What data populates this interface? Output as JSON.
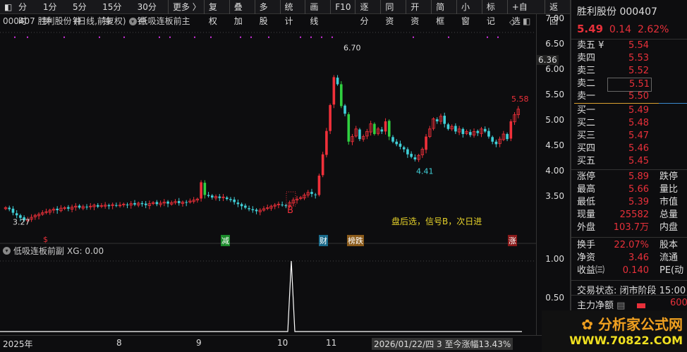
{
  "toolbar": {
    "items": [
      "分时",
      "1分钟",
      "5分钟",
      "15分钟",
      "30分钟",
      "更多 〉",
      "复权",
      "叠加",
      "多股",
      "统计",
      "画线",
      "F10",
      "逐分",
      "同资",
      "开资",
      "简框",
      "小窗",
      "标记",
      "+自选",
      "返回"
    ]
  },
  "info": {
    "title": "000407 胜利股份 (日线,前复权)",
    "indicator": "低吸连板前主"
  },
  "sub": {
    "title": "低吸连板前副",
    "xg": "XG: 0.00"
  },
  "price_axis": [
    "7.00",
    "6.50",
    "6.00",
    "5.50",
    "5.00",
    "4.50",
    "4.00",
    "3.50"
  ],
  "price_tag": "6.36",
  "sub_axis": [
    "1.00",
    "0.50"
  ],
  "annotations": {
    "high": "6.70",
    "low": "4.41",
    "low0": "3.27",
    "last_high": "5.58",
    "b": "B",
    "note": "盘后选，信号B，次日进"
  },
  "signals": [
    {
      "t": "$",
      "c": "#e8303a"
    },
    {
      "t": "减",
      "c": "#1a8a2a"
    },
    {
      "t": "财",
      "c": "#1a6a8a"
    },
    {
      "t": "榜跌",
      "c": "#8a5a1a"
    },
    {
      "t": "涨",
      "c": "#8a1a1a"
    }
  ],
  "xaxis": {
    "labels": [
      "2025年",
      "8",
      "9",
      "10",
      "11"
    ],
    "status": "2026/01/22/四 3 至今涨幅13.43%"
  },
  "chart_data": {
    "type": "candlestick",
    "closes": [
      3.55,
      3.52,
      3.45,
      3.4,
      3.35,
      3.3,
      3.32,
      3.36,
      3.4,
      3.42,
      3.45,
      3.47,
      3.5,
      3.52,
      3.5,
      3.54,
      3.55,
      3.53,
      3.56,
      3.58,
      3.55,
      3.57,
      3.56,
      3.58,
      3.6,
      3.57,
      3.59,
      3.6,
      3.58,
      3.61,
      3.59,
      3.6,
      3.62,
      3.6,
      3.63,
      3.61,
      3.64,
      3.62,
      3.6,
      3.63,
      3.65,
      3.62,
      3.64,
      3.66,
      3.63,
      3.65,
      3.67,
      3.64,
      3.66,
      3.65,
      3.68,
      3.7,
      3.72,
      4.05,
      3.8,
      3.78,
      3.75,
      3.77,
      3.74,
      3.76,
      3.72,
      3.7,
      3.66,
      3.62,
      3.58,
      3.55,
      3.52,
      3.5,
      3.48,
      3.5,
      3.53,
      3.55,
      3.58,
      3.6,
      3.62,
      3.6,
      3.58,
      3.65,
      3.7,
      3.72,
      3.75,
      3.8,
      3.85,
      3.82,
      3.8,
      4.18,
      4.6,
      5.06,
      5.57,
      6.12,
      5.98,
      5.55,
      5.4,
      4.85,
      4.95,
      5.1,
      4.9,
      4.95,
      5.05,
      5.2,
      5.0,
      5.1,
      5.05,
      5.25,
      4.95,
      4.85,
      4.8,
      4.75,
      4.7,
      4.6,
      4.55,
      4.5,
      4.58,
      4.7,
      4.95,
      5.1,
      5.3,
      5.25,
      5.35,
      5.2,
      5.1,
      5.15,
      5.05,
      5.1,
      5.0,
      5.05,
      4.98,
      5.05,
      5.02,
      5.1,
      5.05,
      4.95,
      4.85,
      4.8,
      4.9,
      5.0,
      4.9,
      5.25,
      5.38,
      5.49
    ],
    "ylim": [
      3.2,
      7.1
    ],
    "sub_spike_value": 1.0
  },
  "quote": {
    "name": "胜利股份 000407",
    "price": "5.49",
    "change": "0.14",
    "pct": "2.62%"
  },
  "asks": [
    {
      "l": "卖五 ¥",
      "v": "5.54"
    },
    {
      "l": "卖四",
      "v": "5.53"
    },
    {
      "l": "卖三",
      "v": "5.52"
    },
    {
      "l": "卖二",
      "v": "5.51"
    },
    {
      "l": "卖一",
      "v": "5.50"
    }
  ],
  "bids": [
    {
      "l": "买一",
      "v": "5.49"
    },
    {
      "l": "买二",
      "v": "5.48"
    },
    {
      "l": "买三",
      "v": "5.47"
    },
    {
      "l": "买四",
      "v": "5.46"
    },
    {
      "l": "买五",
      "v": "5.45"
    }
  ],
  "stats": [
    {
      "l": "涨停",
      "v": "5.89",
      "r": "跌停"
    },
    {
      "l": "最高",
      "v": "5.66",
      "r": "量比"
    },
    {
      "l": "最低",
      "v": "5.39",
      "r": "市值"
    },
    {
      "l": "现量",
      "v": "25582",
      "r": "总量"
    },
    {
      "l": "外盘",
      "v": "103.7万",
      "r": "内盘"
    }
  ],
  "stats2": [
    {
      "l": "换手",
      "v": "22.07%",
      "r": "股本"
    },
    {
      "l": "净资",
      "v": "3.46",
      "r": "流通"
    },
    {
      "l": "收益㈢",
      "v": "0.140",
      "r": "PE(动"
    }
  ],
  "status": "交易状态: 闭市阶段 15:00",
  "flow": {
    "label": "主力净额",
    "value": "600"
  },
  "logo": {
    "name": "分析家公式网",
    "url": "WWW.70822.COM"
  }
}
